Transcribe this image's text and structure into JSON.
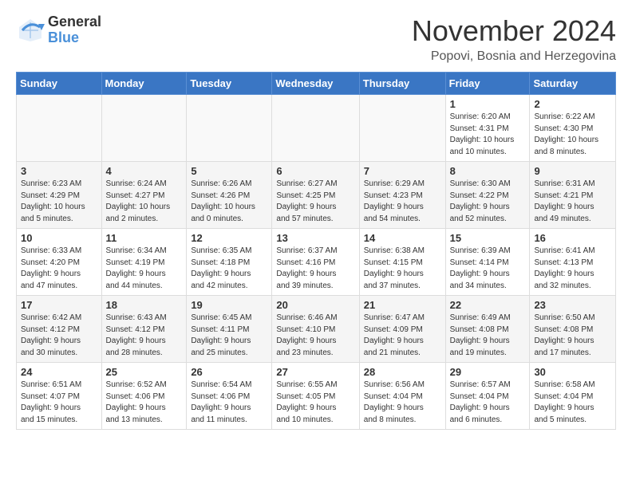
{
  "header": {
    "logo_general": "General",
    "logo_blue": "Blue",
    "month_title": "November 2024",
    "location": "Popovi, Bosnia and Herzegovina"
  },
  "weekdays": [
    "Sunday",
    "Monday",
    "Tuesday",
    "Wednesday",
    "Thursday",
    "Friday",
    "Saturday"
  ],
  "weeks": [
    [
      {
        "day": "",
        "info": ""
      },
      {
        "day": "",
        "info": ""
      },
      {
        "day": "",
        "info": ""
      },
      {
        "day": "",
        "info": ""
      },
      {
        "day": "",
        "info": ""
      },
      {
        "day": "1",
        "info": "Sunrise: 6:20 AM\nSunset: 4:31 PM\nDaylight: 10 hours\nand 10 minutes."
      },
      {
        "day": "2",
        "info": "Sunrise: 6:22 AM\nSunset: 4:30 PM\nDaylight: 10 hours\nand 8 minutes."
      }
    ],
    [
      {
        "day": "3",
        "info": "Sunrise: 6:23 AM\nSunset: 4:29 PM\nDaylight: 10 hours\nand 5 minutes."
      },
      {
        "day": "4",
        "info": "Sunrise: 6:24 AM\nSunset: 4:27 PM\nDaylight: 10 hours\nand 2 minutes."
      },
      {
        "day": "5",
        "info": "Sunrise: 6:26 AM\nSunset: 4:26 PM\nDaylight: 10 hours\nand 0 minutes."
      },
      {
        "day": "6",
        "info": "Sunrise: 6:27 AM\nSunset: 4:25 PM\nDaylight: 9 hours\nand 57 minutes."
      },
      {
        "day": "7",
        "info": "Sunrise: 6:29 AM\nSunset: 4:23 PM\nDaylight: 9 hours\nand 54 minutes."
      },
      {
        "day": "8",
        "info": "Sunrise: 6:30 AM\nSunset: 4:22 PM\nDaylight: 9 hours\nand 52 minutes."
      },
      {
        "day": "9",
        "info": "Sunrise: 6:31 AM\nSunset: 4:21 PM\nDaylight: 9 hours\nand 49 minutes."
      }
    ],
    [
      {
        "day": "10",
        "info": "Sunrise: 6:33 AM\nSunset: 4:20 PM\nDaylight: 9 hours\nand 47 minutes."
      },
      {
        "day": "11",
        "info": "Sunrise: 6:34 AM\nSunset: 4:19 PM\nDaylight: 9 hours\nand 44 minutes."
      },
      {
        "day": "12",
        "info": "Sunrise: 6:35 AM\nSunset: 4:18 PM\nDaylight: 9 hours\nand 42 minutes."
      },
      {
        "day": "13",
        "info": "Sunrise: 6:37 AM\nSunset: 4:16 PM\nDaylight: 9 hours\nand 39 minutes."
      },
      {
        "day": "14",
        "info": "Sunrise: 6:38 AM\nSunset: 4:15 PM\nDaylight: 9 hours\nand 37 minutes."
      },
      {
        "day": "15",
        "info": "Sunrise: 6:39 AM\nSunset: 4:14 PM\nDaylight: 9 hours\nand 34 minutes."
      },
      {
        "day": "16",
        "info": "Sunrise: 6:41 AM\nSunset: 4:13 PM\nDaylight: 9 hours\nand 32 minutes."
      }
    ],
    [
      {
        "day": "17",
        "info": "Sunrise: 6:42 AM\nSunset: 4:12 PM\nDaylight: 9 hours\nand 30 minutes."
      },
      {
        "day": "18",
        "info": "Sunrise: 6:43 AM\nSunset: 4:12 PM\nDaylight: 9 hours\nand 28 minutes."
      },
      {
        "day": "19",
        "info": "Sunrise: 6:45 AM\nSunset: 4:11 PM\nDaylight: 9 hours\nand 25 minutes."
      },
      {
        "day": "20",
        "info": "Sunrise: 6:46 AM\nSunset: 4:10 PM\nDaylight: 9 hours\nand 23 minutes."
      },
      {
        "day": "21",
        "info": "Sunrise: 6:47 AM\nSunset: 4:09 PM\nDaylight: 9 hours\nand 21 minutes."
      },
      {
        "day": "22",
        "info": "Sunrise: 6:49 AM\nSunset: 4:08 PM\nDaylight: 9 hours\nand 19 minutes."
      },
      {
        "day": "23",
        "info": "Sunrise: 6:50 AM\nSunset: 4:08 PM\nDaylight: 9 hours\nand 17 minutes."
      }
    ],
    [
      {
        "day": "24",
        "info": "Sunrise: 6:51 AM\nSunset: 4:07 PM\nDaylight: 9 hours\nand 15 minutes."
      },
      {
        "day": "25",
        "info": "Sunrise: 6:52 AM\nSunset: 4:06 PM\nDaylight: 9 hours\nand 13 minutes."
      },
      {
        "day": "26",
        "info": "Sunrise: 6:54 AM\nSunset: 4:06 PM\nDaylight: 9 hours\nand 11 minutes."
      },
      {
        "day": "27",
        "info": "Sunrise: 6:55 AM\nSunset: 4:05 PM\nDaylight: 9 hours\nand 10 minutes."
      },
      {
        "day": "28",
        "info": "Sunrise: 6:56 AM\nSunset: 4:04 PM\nDaylight: 9 hours\nand 8 minutes."
      },
      {
        "day": "29",
        "info": "Sunrise: 6:57 AM\nSunset: 4:04 PM\nDaylight: 9 hours\nand 6 minutes."
      },
      {
        "day": "30",
        "info": "Sunrise: 6:58 AM\nSunset: 4:04 PM\nDaylight: 9 hours\nand 5 minutes."
      }
    ]
  ]
}
